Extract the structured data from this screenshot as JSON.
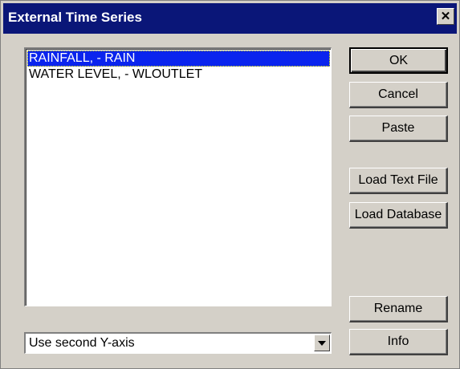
{
  "window": {
    "title": "External Time Series",
    "close_glyph": "✕"
  },
  "list": {
    "items": [
      {
        "label": "RAINFALL, - RAIN",
        "selected": true
      },
      {
        "label": "WATER LEVEL, - WLOUTLET",
        "selected": false
      }
    ]
  },
  "axis_select": {
    "value": "Use second Y-axis"
  },
  "buttons": {
    "ok": "OK",
    "cancel": "Cancel",
    "paste": "Paste",
    "load_text_file": "Load Text File",
    "load_database": "Load Database",
    "rename": "Rename",
    "info": "Info"
  },
  "colors": {
    "titlebar": "#0a1678",
    "selection": "#0a24ee",
    "face": "#d4d0c8"
  }
}
